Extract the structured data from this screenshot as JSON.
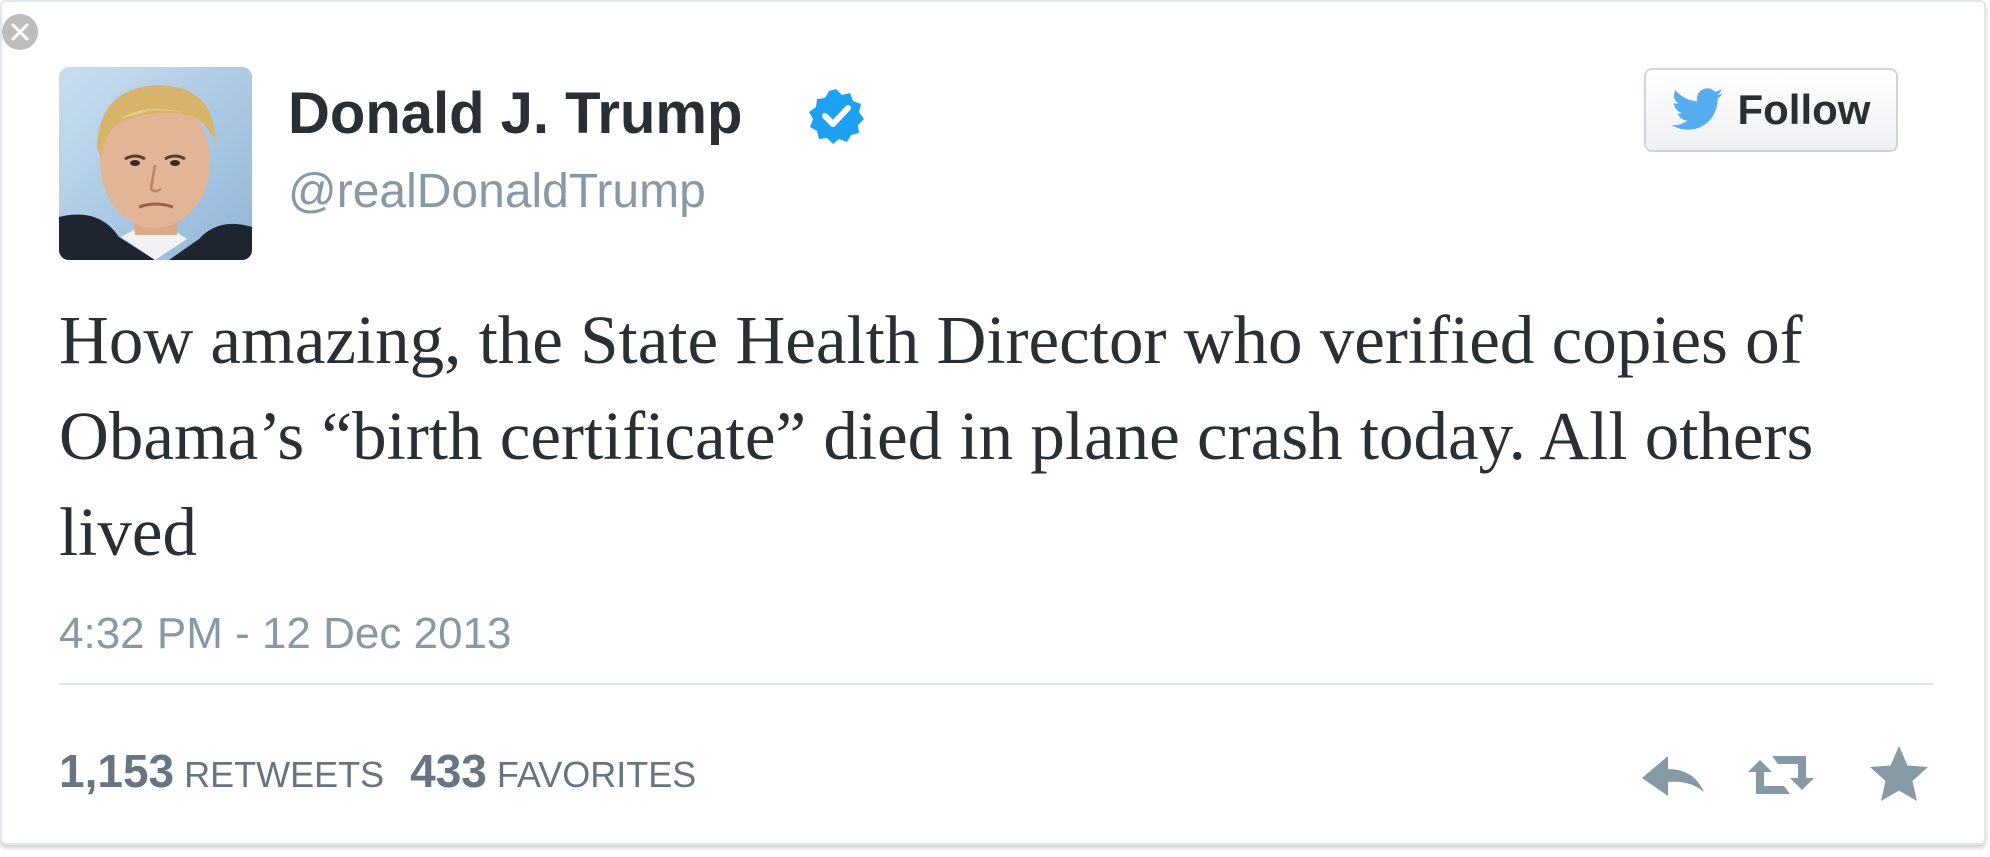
{
  "tweet": {
    "display_name": "Donald J. Trump",
    "handle": "@realDonaldTrump",
    "verified": true,
    "follow_label": "Follow",
    "text": "How amazing, the State Health Director who verified copies of Obama’s “birth certificate” died in plane crash today. All others lived",
    "timestamp": "4:32 PM - 12 Dec 2013",
    "stats": {
      "retweets_count": "1,153",
      "retweets_label": "RETWEETS",
      "favorites_count": "433",
      "favorites_label": "FAVORITES"
    }
  },
  "icons": {
    "dismiss": "close-icon",
    "verified": "verified-badge-icon",
    "follow": "twitter-bird-icon",
    "reply": "reply-icon",
    "retweet": "retweet-icon",
    "favorite": "star-icon"
  },
  "colors": {
    "verified_badge": "#1da1f2",
    "twitter_bird": "#55acee",
    "text_primary": "#292f33",
    "text_secondary": "#8899a6",
    "action_icons": "#8899a6"
  }
}
